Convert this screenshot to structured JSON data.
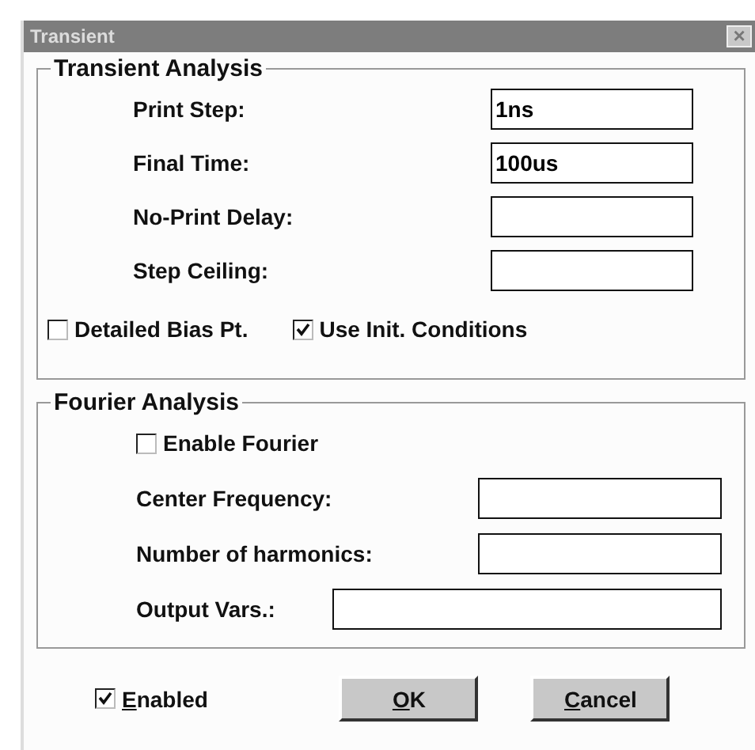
{
  "window": {
    "title": "Transient",
    "close_glyph": "×"
  },
  "transient_analysis": {
    "title": "Transient Analysis",
    "fields": [
      {
        "label": "Print Step:",
        "value": "1ns"
      },
      {
        "label": "Final Time:",
        "value": "100us"
      },
      {
        "label": "No-Print Delay:"
      },
      {
        "label": "Step Ceiling:"
      }
    ],
    "options": [
      {
        "label": "Detailed Bias Pt.",
        "checked": false
      },
      {
        "label": "Use Init. Conditions",
        "checked": true
      }
    ]
  },
  "fourier_analysis": {
    "title": "Fourier Analysis",
    "enable": {
      "label": "Enable Fourier",
      "checked": false
    },
    "fields": [
      {
        "label": "Center Frequency:",
        "kind": "short"
      },
      {
        "label": "Number of harmonics:",
        "kind": "short"
      },
      {
        "label": "Output Vars.:",
        "kind": "wide"
      }
    ]
  },
  "enabled": {
    "label": "Enabled",
    "checked": true
  },
  "buttons": [
    {
      "label": "OK"
    },
    {
      "label": "Cancel"
    }
  ]
}
